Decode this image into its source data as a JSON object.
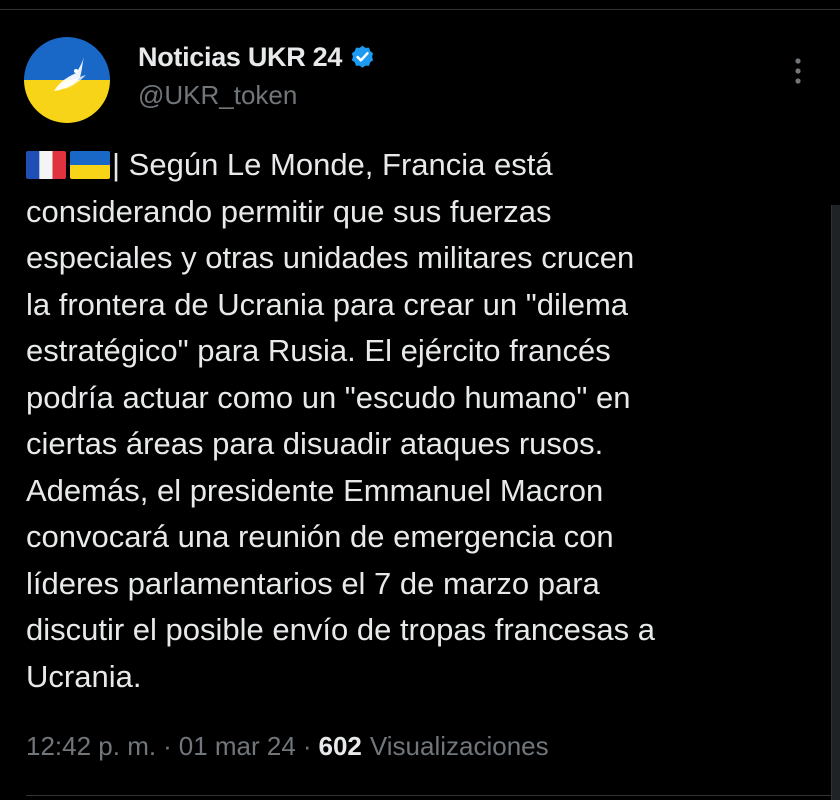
{
  "author": {
    "display_name": "Noticias UKR 24",
    "handle": "@UKR_token",
    "verified_icon": "verified-badge-icon",
    "avatar_icon": "dove-icon"
  },
  "post": {
    "flags": [
      "france-flag-emoji",
      "ukraine-flag-emoji"
    ],
    "text": "| Según Le Monde, Francia está\nconsiderando permitir que sus fuerzas\nespeciales y otras unidades militares crucen\nla frontera de Ucrania para crear un \"dilema\nestratégico\" para Rusia. El ejército francés\npodría actuar como un \"escudo humano\" en\nciertas áreas para disuadir ataques rusos.\nAdemás, el presidente Emmanuel Macron\nconvocará una reunión de emergencia con\nlíderes parlamentarios el 7 de marzo para\ndiscutir el posible envío de tropas francesas a\nUcrania."
  },
  "meta": {
    "time": "12:42 p. m.",
    "separator": "·",
    "date": "01 mar 24",
    "views_count": "602",
    "views_label": "Visualizaciones"
  },
  "menu": {
    "more_icon": "more-vertical-icon"
  },
  "colors": {
    "background": "#000000",
    "text_primary": "#e7e9ea",
    "text_secondary": "#71767b",
    "verified_blue": "#1d9bf0",
    "ukraine_blue": "#1967c7",
    "ukraine_yellow": "#f7d417",
    "divider": "#2f3336"
  }
}
